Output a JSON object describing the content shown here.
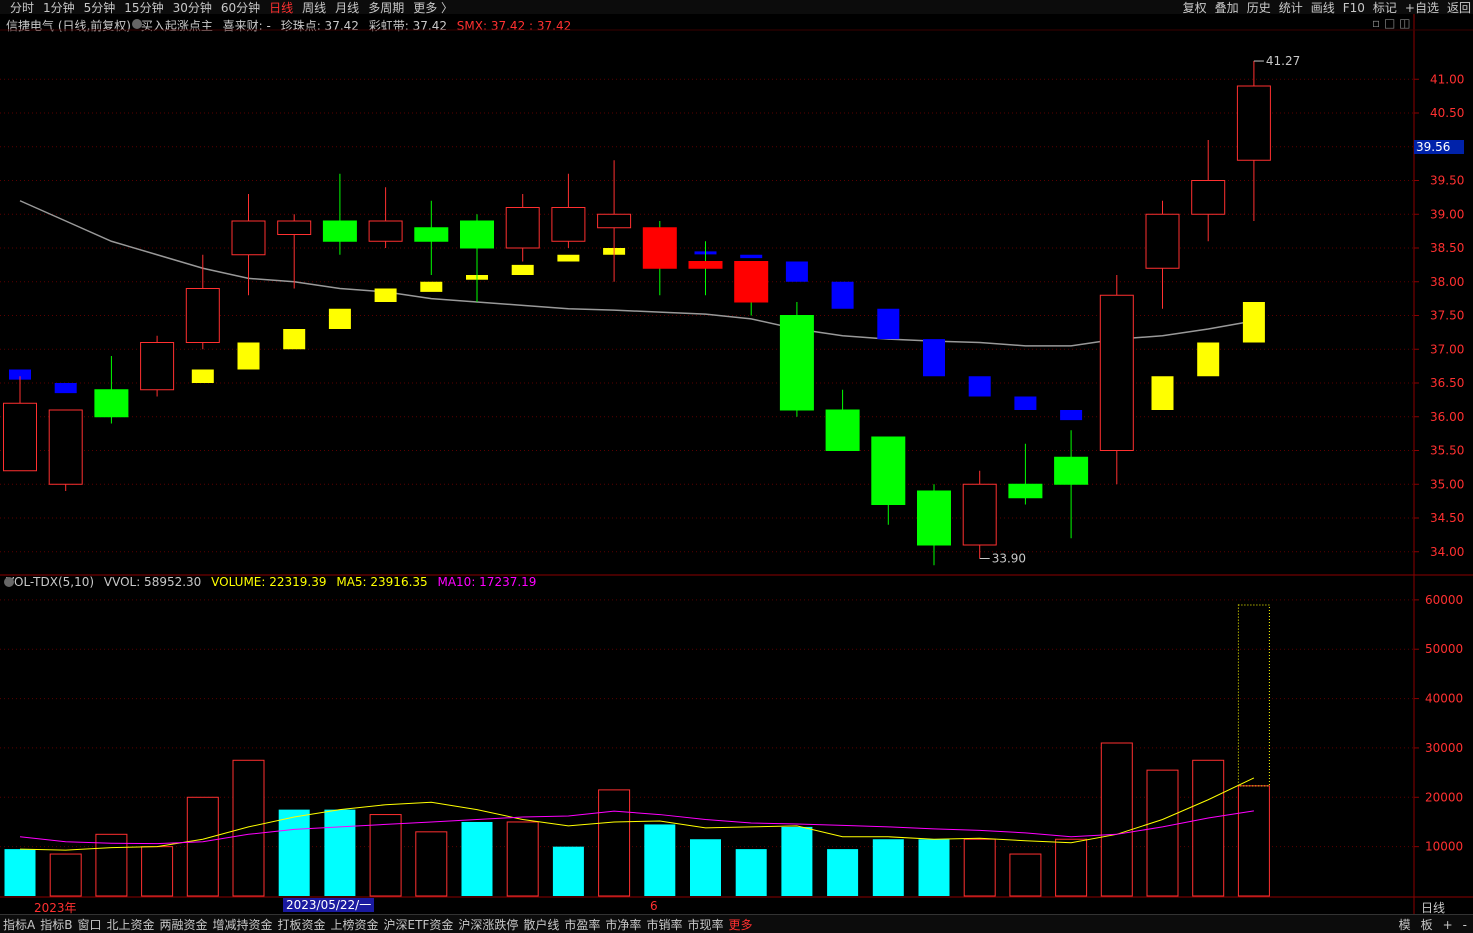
{
  "topbar": {
    "tabs": [
      "分时",
      "1分钟",
      "5分钟",
      "15分钟",
      "30分钟",
      "60分钟",
      "日线",
      "周线",
      "月线",
      "多周期",
      "更多 〉"
    ],
    "active": "日线",
    "right": [
      "复权",
      "叠加",
      "历史",
      "统计",
      "画线",
      "F10",
      "标记",
      "+自选",
      "返回"
    ]
  },
  "main_legend": {
    "stock": "信捷电气 (日线,前复权)",
    "indicator": "买入起涨点主",
    "xilaicai": "喜来财: -",
    "zhenzhudian": "珍珠点: 37.42",
    "caihongdai": "彩虹带: 37.42",
    "smx": "SMX: 37.42 : 37.42"
  },
  "vol_legend": {
    "name": "VOL-TDX(5,10)",
    "vvol": "VVOL: 58952.30",
    "volume": "VOLUME: 22319.39",
    "ma5": "MA5: 23916.35",
    "ma10": "MA10: 17237.19"
  },
  "price_box": "39.56",
  "date_box": "2023/05/22/一",
  "x_labels": [
    "2023年",
    "6"
  ],
  "period_tag": "日线",
  "bottom_tabs": [
    "指标A",
    "指标B",
    "窗口",
    "北上资金",
    "两融资金",
    "增减持资金",
    "打板资金",
    "上榜资金",
    "沪深ETF资金",
    "沪深涨跌停",
    "散户线",
    "市盈率",
    "市净率",
    "市销率",
    "市现率",
    "更多"
  ],
  "bottom_right": [
    "模",
    "板",
    "+",
    "-"
  ],
  "colors": {
    "up": "#ff3030",
    "down": "#00ff00",
    "vol_down": "#00ffff",
    "ma5": "#ffff00",
    "ma10": "#ff00ff",
    "grid": "#5a0000"
  },
  "chart_data": [
    {
      "type": "candlestick",
      "yticks": [
        34.0,
        34.5,
        35.0,
        35.5,
        36.0,
        36.5,
        37.0,
        37.5,
        38.0,
        38.5,
        39.0,
        39.5,
        40.0,
        40.5,
        41.0
      ],
      "ylim": [
        33.7,
        41.7
      ],
      "annotations": [
        {
          "label": "41.27",
          "value": 41.27,
          "bar": 27
        },
        {
          "label": "33.90",
          "value": 33.9,
          "bar": 21
        }
      ],
      "candles": [
        {
          "o": 35.2,
          "h": 36.6,
          "l": 35.2,
          "c": 36.2
        },
        {
          "o": 35.0,
          "h": 36.1,
          "l": 34.9,
          "c": 36.1
        },
        {
          "o": 36.4,
          "h": 36.9,
          "l": 35.9,
          "c": 36.0
        },
        {
          "o": 36.4,
          "h": 37.2,
          "l": 36.3,
          "c": 37.1
        },
        {
          "o": 37.1,
          "h": 38.4,
          "l": 37.0,
          "c": 37.9
        },
        {
          "o": 38.4,
          "h": 39.3,
          "l": 37.8,
          "c": 38.9
        },
        {
          "o": 38.7,
          "h": 39.0,
          "l": 37.9,
          "c": 38.9
        },
        {
          "o": 38.9,
          "h": 39.6,
          "l": 38.4,
          "c": 38.6
        },
        {
          "o": 38.6,
          "h": 39.4,
          "l": 38.5,
          "c": 38.9
        },
        {
          "o": 38.8,
          "h": 39.2,
          "l": 38.1,
          "c": 38.6
        },
        {
          "o": 38.9,
          "h": 39.0,
          "l": 37.7,
          "c": 38.5
        },
        {
          "o": 38.5,
          "h": 39.3,
          "l": 38.3,
          "c": 39.1
        },
        {
          "o": 38.6,
          "h": 39.6,
          "l": 38.5,
          "c": 39.1
        },
        {
          "o": 38.8,
          "h": 39.8,
          "l": 38.0,
          "c": 39.0
        },
        {
          "o": 38.8,
          "h": 38.9,
          "l": 37.8,
          "c": 38.2
        },
        {
          "o": 38.3,
          "h": 38.6,
          "l": 37.8,
          "c": 38.2
        },
        {
          "o": 38.3,
          "h": 38.3,
          "l": 37.5,
          "c": 37.7
        },
        {
          "o": 37.5,
          "h": 37.7,
          "l": 36.0,
          "c": 36.1
        },
        {
          "o": 36.1,
          "h": 36.4,
          "l": 35.5,
          "c": 35.5
        },
        {
          "o": 35.7,
          "h": 35.7,
          "l": 34.4,
          "c": 34.7
        },
        {
          "o": 34.9,
          "h": 35.0,
          "l": 33.8,
          "c": 34.1
        },
        {
          "o": 34.1,
          "h": 35.2,
          "l": 33.9,
          "c": 35.0
        },
        {
          "o": 35.0,
          "h": 35.6,
          "l": 34.7,
          "c": 34.8
        },
        {
          "o": 35.4,
          "h": 35.8,
          "l": 34.2,
          "c": 35.0
        },
        {
          "o": 35.5,
          "h": 38.1,
          "l": 35.0,
          "c": 37.8
        },
        {
          "o": 38.2,
          "h": 39.2,
          "l": 37.6,
          "c": 39.0
        },
        {
          "o": 39.0,
          "h": 40.1,
          "l": 38.6,
          "c": 39.5
        },
        {
          "o": 39.8,
          "h": 41.27,
          "l": 38.9,
          "c": 40.9
        }
      ],
      "signals": [
        {
          "top": 36.7,
          "bot": 36.55,
          "color": "blue"
        },
        {
          "top": 36.5,
          "bot": 36.35,
          "color": "blue"
        },
        {
          "top": 36.4,
          "bot": 36.37,
          "color": "yellow"
        },
        {
          "top": 36.5,
          "bot": 36.4,
          "color": "yellow"
        },
        {
          "top": 36.7,
          "bot": 36.5,
          "color": "yellow"
        },
        {
          "top": 37.1,
          "bot": 36.7,
          "color": "yellow"
        },
        {
          "top": 37.3,
          "bot": 37.0,
          "color": "yellow"
        },
        {
          "top": 37.6,
          "bot": 37.3,
          "color": "yellow"
        },
        {
          "top": 37.9,
          "bot": 37.7,
          "color": "yellow"
        },
        {
          "top": 38.0,
          "bot": 37.85,
          "color": "yellow"
        },
        {
          "top": 38.1,
          "bot": 38.03,
          "color": "yellow"
        },
        {
          "top": 38.25,
          "bot": 38.1,
          "color": "yellow"
        },
        {
          "top": 38.4,
          "bot": 38.3,
          "color": "yellow"
        },
        {
          "top": 38.5,
          "bot": 38.4,
          "color": "yellow"
        },
        {
          "top": 38.5,
          "bot": 38.47,
          "color": "blue"
        },
        {
          "top": 38.45,
          "bot": 38.42,
          "color": "blue"
        },
        {
          "top": 38.4,
          "bot": 38.35,
          "color": "blue"
        },
        {
          "top": 38.3,
          "bot": 38.0,
          "color": "blue"
        },
        {
          "top": 38.0,
          "bot": 37.6,
          "color": "blue"
        },
        {
          "top": 37.6,
          "bot": 37.15,
          "color": "blue"
        },
        {
          "top": 37.15,
          "bot": 36.6,
          "color": "blue"
        },
        {
          "top": 36.6,
          "bot": 36.3,
          "color": "blue"
        },
        {
          "top": 36.3,
          "bot": 36.1,
          "color": "blue"
        },
        {
          "top": 36.1,
          "bot": 35.95,
          "color": "blue"
        },
        {
          "top": 36.1,
          "bot": 35.9,
          "color": "yellow"
        },
        {
          "top": 36.6,
          "bot": 36.1,
          "color": "yellow"
        },
        {
          "top": 37.1,
          "bot": 36.6,
          "color": "yellow"
        },
        {
          "top": 37.7,
          "bot": 37.1,
          "color": "yellow"
        }
      ],
      "ma_line": [
        39.2,
        38.9,
        38.6,
        38.4,
        38.2,
        38.05,
        38.0,
        37.9,
        37.85,
        37.75,
        37.7,
        37.65,
        37.6,
        37.58,
        37.55,
        37.52,
        37.45,
        37.3,
        37.2,
        37.15,
        37.12,
        37.1,
        37.05,
        37.05,
        37.15,
        37.2,
        37.3,
        37.42
      ]
    },
    {
      "type": "bar",
      "yticks": [
        10000,
        20000,
        30000,
        40000,
        50000,
        60000
      ],
      "ylim": [
        0,
        62000
      ],
      "volume": [
        9500,
        8500,
        12500,
        10000,
        20000,
        27500,
        17500,
        17500,
        16500,
        13000,
        15000,
        15000,
        10000,
        21500,
        14500,
        11500,
        9500,
        14000,
        9500,
        11500,
        11500,
        11500,
        8500,
        11500,
        31000,
        25500,
        27500,
        22319.39
      ],
      "direction": [
        "down",
        "up",
        "up",
        "up",
        "up",
        "up",
        "down",
        "down",
        "up",
        "up",
        "down",
        "up",
        "down",
        "up",
        "down",
        "down",
        "down",
        "down",
        "down",
        "down",
        "down",
        "up",
        "up",
        "up",
        "up",
        "up",
        "up",
        "up"
      ],
      "vvol": 58952.3,
      "ma5": [
        9500,
        9300,
        9800,
        10000,
        11500,
        14000,
        16000,
        17500,
        18500,
        19000,
        17500,
        15500,
        14200,
        15000,
        15200,
        13800,
        14000,
        14200,
        12000,
        12000,
        11500,
        11700,
        11200,
        10800,
        12500,
        15500,
        19500,
        23916.35
      ],
      "ma10": [
        12000,
        11000,
        10700,
        10600,
        11000,
        12500,
        13500,
        14000,
        14500,
        15000,
        15500,
        16000,
        16200,
        17200,
        16500,
        15500,
        14800,
        14600,
        14300,
        14000,
        13600,
        13300,
        12800,
        12000,
        12500,
        14000,
        15800,
        17237.19
      ]
    }
  ]
}
